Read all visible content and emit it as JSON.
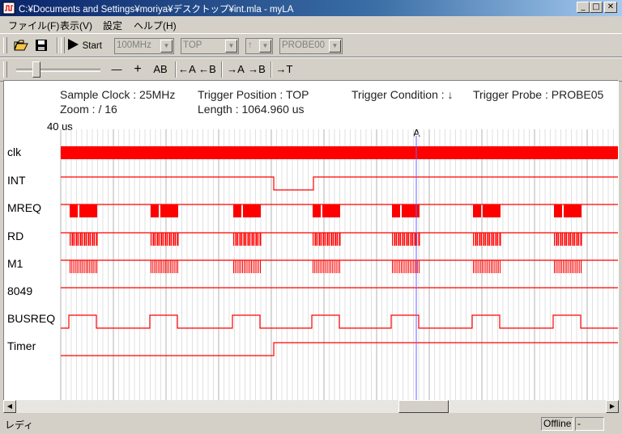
{
  "window": {
    "title": "C:¥Documents and Settings¥moriya¥デスクトップ¥int.mla - myLA"
  },
  "menu": [
    "ファイル(F)",
    "表示(V)",
    "設定",
    "ヘルプ(H)"
  ],
  "toolbar1": {
    "start_label": "Start",
    "clock_combo": "100MHz",
    "position_combo": "TOP",
    "edge_combo": "↑",
    "probe_combo": "PROBE00"
  },
  "toolbar2": {
    "zoom_out": "—",
    "zoom_in": "+",
    "ab": "AB",
    "left_a": "←A",
    "left_b": "←B",
    "right_a": "→A",
    "right_b": "→B",
    "to_t": "→T"
  },
  "info": {
    "sample_clock": "Sample Clock : 25MHz",
    "zoom": "Zoom :  /   16",
    "trigger_position": "Trigger Position : TOP",
    "length": "Length : 1064.960 us",
    "trigger_condition": "Trigger Condition : ↓",
    "trigger_probe": "Trigger Probe : PROBE05"
  },
  "time_scale_label": "40 us",
  "cursor_label": "A",
  "signals": [
    "clk",
    "INT",
    "MREQ",
    "RD",
    "M1",
    "8049",
    "BUSREQ",
    "Timer"
  ],
  "status": {
    "text": "レディ",
    "connection": "Offline",
    "extra": "-"
  },
  "colors": {
    "signal": "#ff0000",
    "cursor": "#6666ff",
    "major_grid": "#b0b0b0",
    "minor_grid": "#e0e0e0"
  }
}
